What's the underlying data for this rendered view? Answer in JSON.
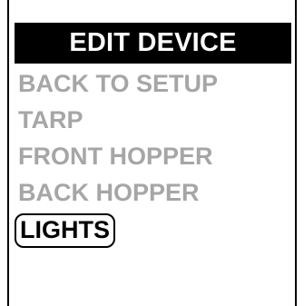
{
  "header": {
    "title": "EDIT DEVICE"
  },
  "menu": {
    "items": [
      {
        "label": "BACK TO SETUP",
        "selected": false
      },
      {
        "label": "TARP",
        "selected": false
      },
      {
        "label": "FRONT HOPPER",
        "selected": false
      },
      {
        "label": "BACK HOPPER",
        "selected": false
      },
      {
        "label": "LIGHTS",
        "selected": true
      }
    ]
  },
  "colors": {
    "title_background": "#000000",
    "title_text": "#ffffff",
    "item_unselected": "#a6a6a6",
    "item_selected": "#000000"
  }
}
